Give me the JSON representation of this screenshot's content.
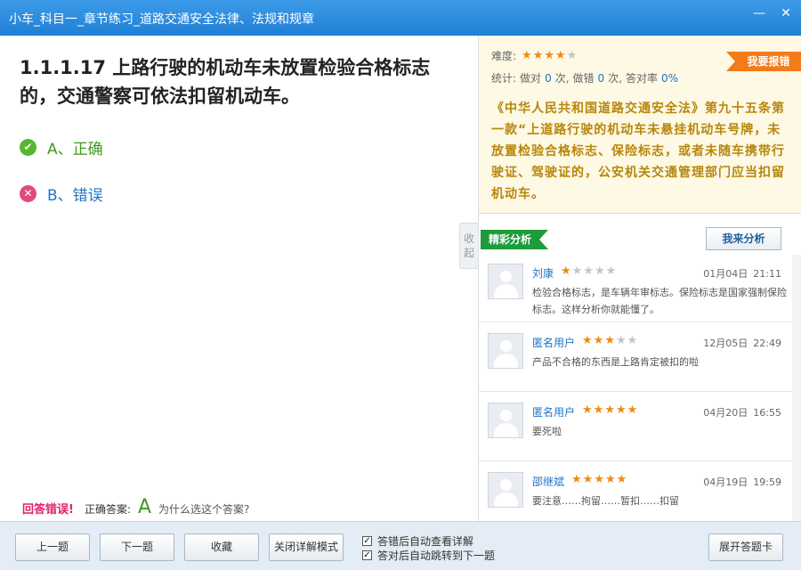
{
  "window": {
    "title": "小车_科目一_章节练习_道路交通安全法律、法规和规章",
    "minimize_glyph": "—",
    "close_glyph": "✕"
  },
  "question": {
    "text": "1.1.1.17 上路行驶的机动车未放置检验合格标志的，交通警察可依法扣留机动车。",
    "options": [
      {
        "label": "A、正确",
        "icon": "check-icon"
      },
      {
        "label": "B、错误",
        "icon": "cross-icon"
      }
    ]
  },
  "answer": {
    "wrong_label": "回答错误!",
    "correct_label": "正确答案:",
    "correct_value": "A",
    "why_link": "为什么选这个答案?"
  },
  "collapse_label": "收起",
  "explain": {
    "difficulty_label": "难度:",
    "difficulty_rating": 4,
    "stats_label": "统计:",
    "done_label": "做对",
    "done_count": "0",
    "times1": "次,",
    "wrong_label": "做错",
    "wrong_count": "0",
    "times2": "次,",
    "rate_label": "答对率",
    "rate_value": "0%",
    "report_button": "我要报错",
    "text": "《中华人民共和国道路交通安全法》第九十五条第一款“上道路行驶的机动车未悬挂机动车号牌，未放置检验合格标志、保险标志，或者未随车携带行驶证、驾驶证的，公安机关交通管理部门应当扣留机动车。"
  },
  "analysis": {
    "tag": "精彩分析",
    "my_button": "我来分析",
    "comments": [
      {
        "user": "刘康",
        "rating": 1,
        "date": "01月04日",
        "time": "21:11",
        "text": "检验合格标志，是车辆年审标志。保险标志是国家强制保险标志。这样分析你就能懂了。"
      },
      {
        "user": "匿名用户",
        "rating": 3,
        "date": "12月05日",
        "time": "22:49",
        "text": "产品不合格的东西是上路肯定被扣的啦"
      },
      {
        "user": "匿名用户",
        "rating": 5,
        "date": "04月20日",
        "time": "16:55",
        "text": "要死啦"
      },
      {
        "user": "邵继斌",
        "rating": 5,
        "date": "04月19日",
        "time": "19:59",
        "text": "要注意……拘留……暂扣……扣留"
      }
    ]
  },
  "toolbar": {
    "prev": "上一题",
    "next": "下一题",
    "favorite": "收藏",
    "close_detail": "关闭详解模式",
    "auto_detail": "答错后自动查看详解",
    "auto_next": "答对后自动跳转到下一题",
    "open_card": "展开答题卡"
  },
  "colors": {
    "title_bar": "#2a8be0",
    "correct_green": "#3f9a21",
    "wrong_pink": "#e04b79",
    "star_orange": "#f08a10",
    "explain_gold": "#b8860b",
    "report_orange": "#f27b1a",
    "analysis_green": "#1e9b3a"
  }
}
